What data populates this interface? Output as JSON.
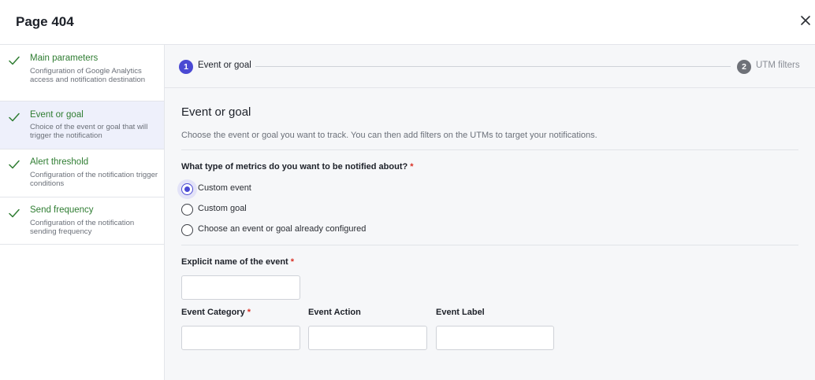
{
  "header": {
    "title": "Page 404",
    "close_icon": "close-icon"
  },
  "sidebar": {
    "items": [
      {
        "label": "Main parameters",
        "description": "Configuration of Google Analytics access and notification destination",
        "icon": "check-icon",
        "active": false
      },
      {
        "label": "Event or goal",
        "description": "Choice of the event or goal that will trigger the notification",
        "icon": "check-icon",
        "active": true
      },
      {
        "label": "Alert threshold",
        "description": "Configuration of the notification trigger conditions",
        "icon": "check-icon",
        "active": false
      },
      {
        "label": "Send frequency",
        "description": "Configuration of the notification sending frequency",
        "icon": "check-icon",
        "active": false
      }
    ]
  },
  "stepper": {
    "steps": [
      {
        "number": "1",
        "label": "Event or goal",
        "status": "current"
      },
      {
        "number": "2",
        "label": "UTM filters",
        "status": "upcoming"
      }
    ]
  },
  "main": {
    "title": "Event or goal",
    "description": "Choose the event or goal you want to track. You can then add filters on the UTMs to target your notifications.",
    "question": "What type of metrics do you want to be notified about?",
    "required_mark": "*",
    "options": [
      {
        "label": "Custom event",
        "selected": true
      },
      {
        "label": "Custom goal",
        "selected": false
      },
      {
        "label": "Choose an event or goal already configured",
        "selected": false
      }
    ],
    "fields": {
      "event_name": {
        "label": "Explicit name of the event",
        "required": true,
        "value": ""
      },
      "event_category": {
        "label": "Event Category",
        "required": true,
        "value": ""
      },
      "event_action": {
        "label": "Event Action",
        "required": false,
        "value": ""
      },
      "event_label": {
        "label": "Event Label",
        "required": false,
        "value": ""
      }
    }
  },
  "colors": {
    "accent": "#4a49d3",
    "success": "#2f7d32",
    "required": "#d93025",
    "active_bg": "#eef0fb"
  }
}
